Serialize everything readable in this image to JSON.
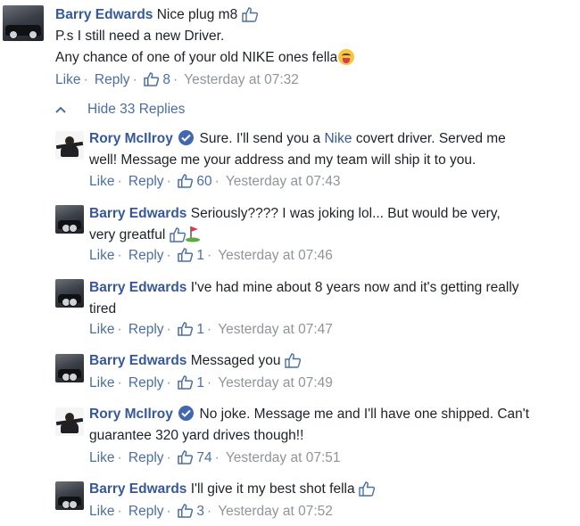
{
  "top_comment": {
    "author": "Barry Edwards",
    "text_line1": "Nice plug m8",
    "text_line2": "P.s I still need a new Driver.",
    "text_line3": "Any chance of one of your old NIKE ones fella",
    "like_label": "Like",
    "reply_label": "Reply",
    "likes": "8",
    "timestamp": "Yesterday at 07:32"
  },
  "hide_replies": {
    "caret": "^",
    "label": "Hide 33 Replies"
  },
  "replies": [
    {
      "author": "Rory McIlroy",
      "text_pre": "Sure. I'll send you a",
      "text_link": "Nike",
      "text_post": "covert driver. Served me",
      "text_line2": "well! Message me your address and my team will ship it to you.",
      "like_label": "Like",
      "reply_label": "Reply",
      "likes": "60",
      "timestamp": "Yesterday at 07:43"
    },
    {
      "author": "Barry Edwards",
      "text_line1": "Seriously???? I was joking lol... But would be very,",
      "text_line2": "very greatful",
      "like_label": "Like",
      "reply_label": "Reply",
      "likes": "1",
      "timestamp": "Yesterday at 07:46"
    },
    {
      "author": "Barry Edwards",
      "text_line1": "I've had mine about 8 years now and it's getting really",
      "text_line2": "tired",
      "like_label": "Like",
      "reply_label": "Reply",
      "likes": "1",
      "timestamp": "Yesterday at 07:47"
    },
    {
      "author": "Barry Edwards",
      "text_line1": "Messaged you",
      "like_label": "Like",
      "reply_label": "Reply",
      "likes": "1",
      "timestamp": "Yesterday at 07:49"
    },
    {
      "author": "Rory McIlroy",
      "text_line1": "No joke. Message me and I'll have one shipped. Can't",
      "text_line2": "guarantee 320 yard drives though!!",
      "like_label": "Like",
      "reply_label": "Reply",
      "likes": "74",
      "timestamp": "Yesterday at 07:51"
    },
    {
      "author": "Barry Edwards",
      "text_line1": "I'll give it my best shot fella",
      "like_label": "Like",
      "reply_label": "Reply",
      "likes": "3",
      "timestamp": "Yesterday at 07:52"
    }
  ],
  "colors": {
    "name": "#365899",
    "link": "#4b6ea6",
    "meta": "#90949c",
    "verified": "#4267b2"
  },
  "icons": {
    "like_small": "thumbs-up-icon",
    "like_outline": "thumbs-up-outline-icon",
    "verified": "verified-badge-icon",
    "emoji": "tongue-out-emoji-icon",
    "golf": "golf-flag-icon"
  }
}
